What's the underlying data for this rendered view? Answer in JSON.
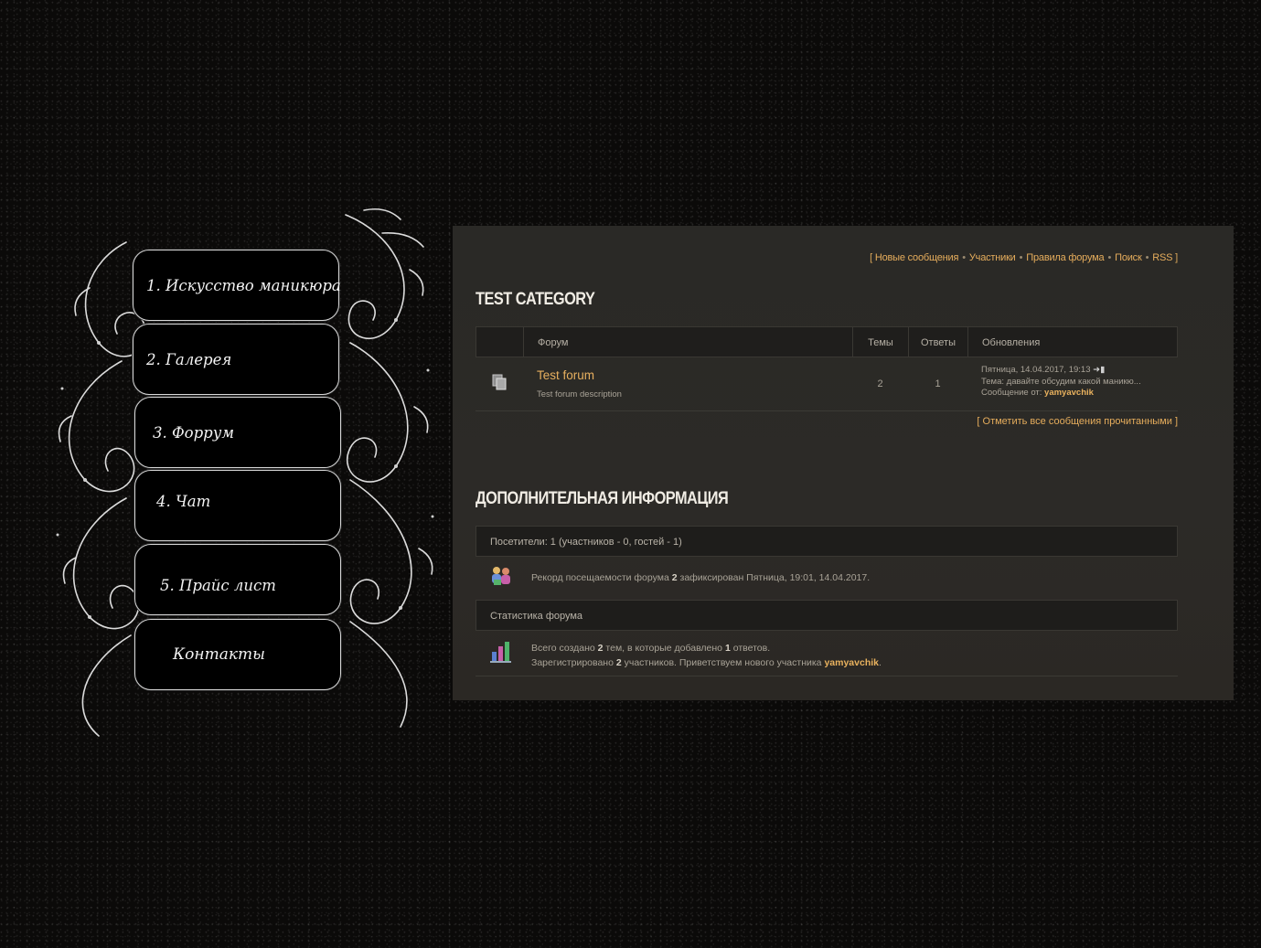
{
  "menu": {
    "items": [
      {
        "label": "1. Искусство маникюра"
      },
      {
        "label": "2. Галерея"
      },
      {
        "label": "3. Форрум"
      },
      {
        "label": "4. Чат"
      },
      {
        "label": "5. Прайс лист"
      },
      {
        "label": "Контакты"
      }
    ]
  },
  "toplinks": {
    "open": "[",
    "close": "]",
    "sep": "•",
    "items": [
      "Новые сообщения",
      "Участники",
      "Правила форума",
      "Поиск",
      "RSS"
    ]
  },
  "category": {
    "title": "TEST CATEGORY",
    "headers": {
      "forum": "Форум",
      "topics": "Темы",
      "replies": "Ответы",
      "updates": "Обновления"
    },
    "forum": {
      "name": "Test forum",
      "description": "Test forum description",
      "topics": "2",
      "replies": "1",
      "last_date": "Пятница, 14.04.2017, 19:13",
      "last_topic_prefix": "Тема:",
      "last_topic": "давайте обсудим какой маникю...",
      "last_author_prefix": "Сообщение от:",
      "last_author": "yamyavchik"
    },
    "mark_read": "[ Отметить все сообщения прочитанными ]"
  },
  "info": {
    "title": "ДОПОЛНИТЕЛЬНАЯ ИНФОРМАЦИЯ",
    "visitors": "Посетители: 1  (участников - 0, гостей - 1)",
    "record_a": "Рекорд посещаемости форума",
    "record_n": "2",
    "record_b": "зафиксирован Пятница, 19:01, 14.04.2017.",
    "stats_header": "Статистика форума",
    "stats_l1_a": "Всего создано",
    "stats_l1_n1": "2",
    "stats_l1_b": "тем, в которые добавлено",
    "stats_l1_n2": "1",
    "stats_l1_c": "ответов.",
    "stats_l2_a": "Зарегистрировано",
    "stats_l2_n": "2",
    "stats_l2_b": "участников. Приветствуем нового участника",
    "stats_l2_user": "yamyavchik",
    "stats_l2_end": "."
  },
  "colors": {
    "accent": "#e9b25e",
    "panel": "#2a2926",
    "menu_bg": "#000000"
  },
  "icons": [
    "forum-folder-icon",
    "last-post-icon",
    "users-online-icon",
    "statistics-icon"
  ]
}
